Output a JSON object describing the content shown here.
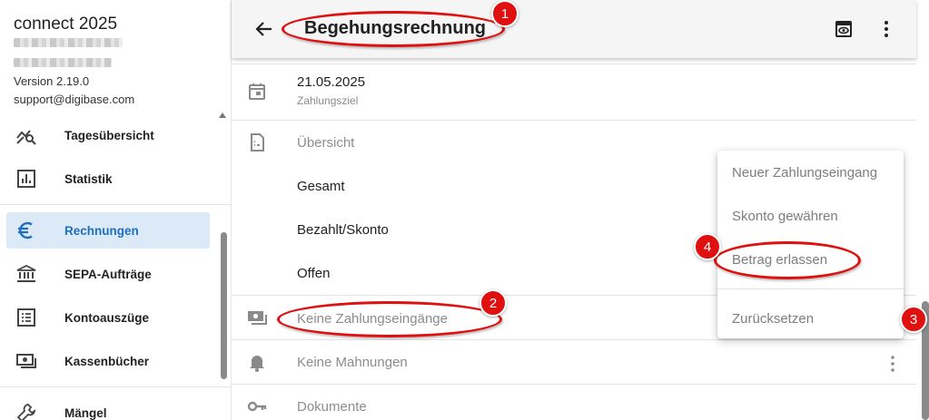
{
  "sidebar": {
    "app_title": "connect 2025",
    "version": "Version 2.19.0",
    "support": "support@digibase.com",
    "items": [
      {
        "label": "Tagesübersicht",
        "icon": "chart-search-icon"
      },
      {
        "label": "Statistik",
        "icon": "bar-chart-icon"
      },
      {
        "label": "Rechnungen",
        "icon": "euro-icon"
      },
      {
        "label": "SEPA-Aufträge",
        "icon": "bank-icon"
      },
      {
        "label": "Kontoauszüge",
        "icon": "list-icon"
      },
      {
        "label": "Kassenbücher",
        "icon": "cash-icon"
      },
      {
        "label": "Mängel",
        "icon": "wrench-icon"
      }
    ],
    "active_item": "Rechnungen",
    "accent_color": "#1e6fc2"
  },
  "header": {
    "title": "Begehungsrechnung",
    "back_icon": "arrow-left-icon",
    "preview_icon": "eye-preview-icon",
    "more_icon": "more-vert-icon"
  },
  "detail": {
    "date_value": "21.05.2025",
    "date_caption": "Zahlungsziel",
    "overview_label": "Übersicht",
    "overview_rows": [
      "Gesamt",
      "Bezahlt/Skonto",
      "Offen"
    ],
    "payments_label": "Keine Zahlungseingänge",
    "reminders_label": "Keine Mahnungen",
    "documents_label": "Dokumente"
  },
  "context_menu": {
    "items": [
      "Neuer Zahlungseingang",
      "Skonto gewähren",
      "Betrag erlassen",
      "Zurücksetzen"
    ]
  },
  "annotations": {
    "badges": [
      "1",
      "2",
      "3",
      "4"
    ],
    "color": "#e01010"
  }
}
